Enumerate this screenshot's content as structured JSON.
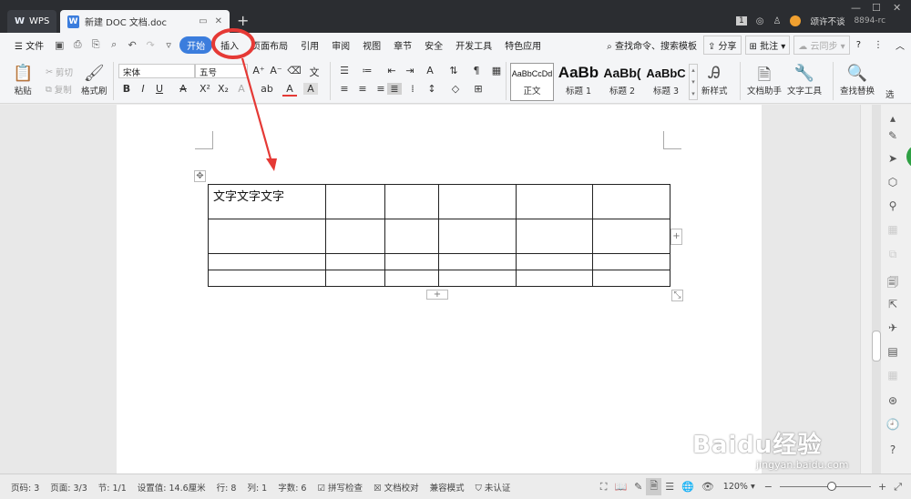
{
  "titlebar": {
    "app_tab": "WPS",
    "doc_tab": "新建 DOC 文档.doc",
    "user": "颂许不谈",
    "extra": "8894-rc",
    "badge": "1"
  },
  "menu": {
    "file": "文件",
    "items": [
      "开始",
      "插入",
      "页面布局",
      "引用",
      "审阅",
      "视图",
      "章节",
      "安全",
      "开发工具",
      "特色应用"
    ],
    "search": "查找命令、搜索模板",
    "share": "分享",
    "comment": "批注",
    "sync": "云同步",
    "help": "?"
  },
  "ribbon": {
    "paste": "粘贴",
    "cut": "剪切",
    "copy": "复制",
    "format_painter": "格式刷",
    "font": "宋体",
    "size": "五号",
    "styles": [
      {
        "preview": "AaBbCcDd",
        "label": "正文"
      },
      {
        "preview": "AaBb",
        "label": "标题 1"
      },
      {
        "preview": "AaBb(",
        "label": "标题 2"
      },
      {
        "preview": "AaBbC",
        "label": "标题 3"
      }
    ],
    "new_style": "新样式",
    "doc_helper": "文档助手",
    "text_tools": "文字工具",
    "find_replace": "查找替换",
    "select": "选"
  },
  "table": {
    "cell_text": "文字文字文字"
  },
  "status": {
    "page": "页码: 3",
    "pages": "页面: 3/3",
    "section": "节: 1/1",
    "setting": "设置值: 14.6厘米",
    "row": "行: 8",
    "col": "列: 1",
    "words": "字数: 6",
    "spell": "拼写检查",
    "proof": "文档校对",
    "compat": "兼容模式",
    "cert": "未认证",
    "zoom": "120%"
  },
  "watermark": {
    "brand": "Baidu经验",
    "url": "jingyan.baidu.com"
  },
  "colors": {
    "accent": "#3b7ddd",
    "annotation": "#e53935",
    "titlebar": "#2b2d31"
  }
}
